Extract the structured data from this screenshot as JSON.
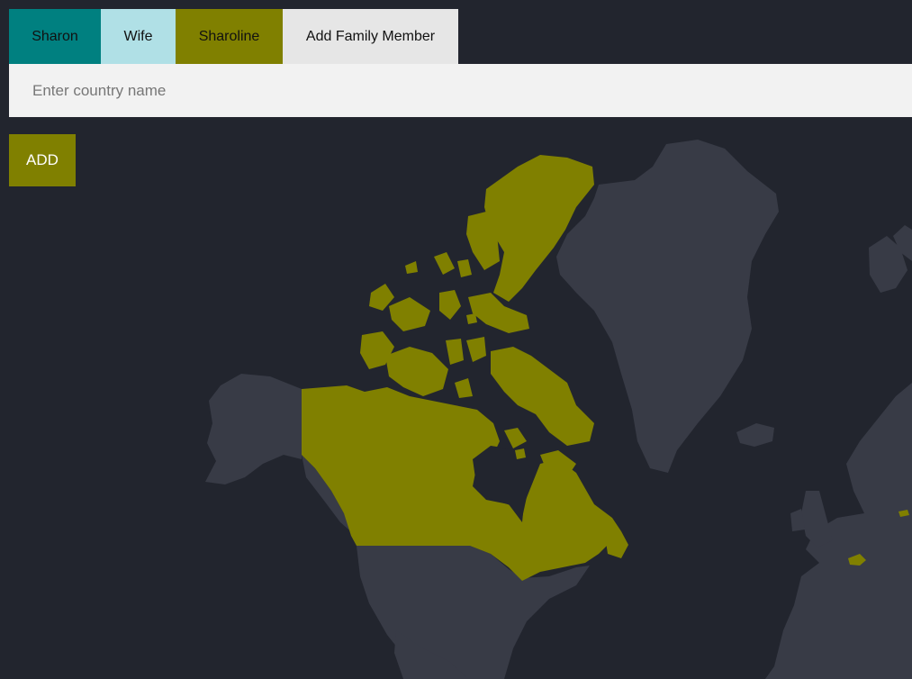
{
  "tabs": [
    {
      "label": "Sharon",
      "color": "#008080"
    },
    {
      "label": "Wife",
      "color": "#b0e0e6"
    },
    {
      "label": "Sharoline",
      "color": "#808000"
    },
    {
      "label": "Add Family Member",
      "color": "#e6e6e6"
    }
  ],
  "search": {
    "placeholder": "Enter country name"
  },
  "add_button": {
    "label": "ADD",
    "color": "#808000"
  },
  "map": {
    "land_color": "#383b46",
    "water_color": "#22252e",
    "highlight_color": "#808000",
    "highlighted_countries": [
      "Canada",
      "Switzerland"
    ]
  }
}
